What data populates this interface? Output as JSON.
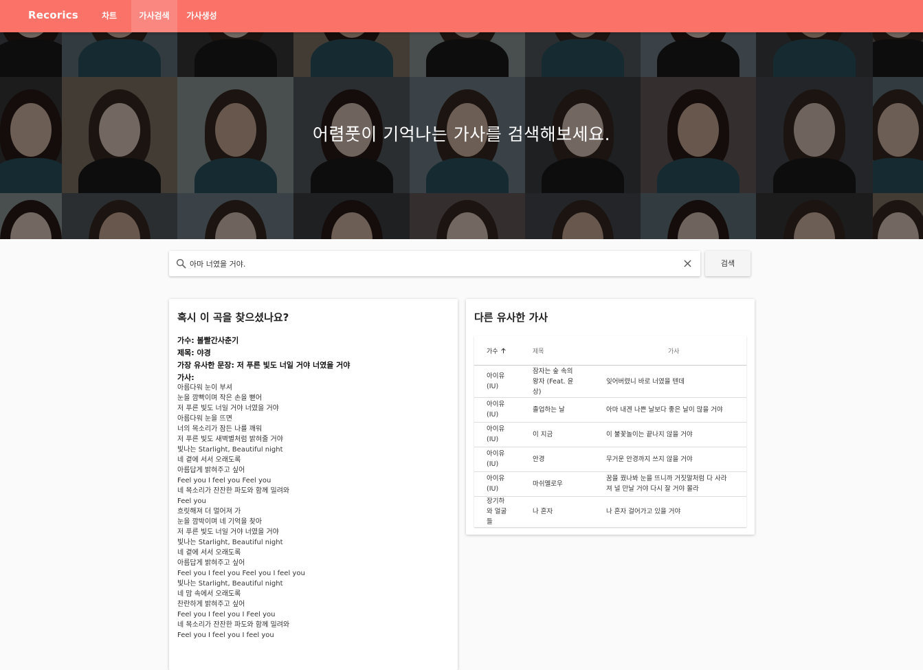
{
  "app": {
    "brand": "Recorics"
  },
  "nav": {
    "items": [
      {
        "label": "차트",
        "active": false
      },
      {
        "label": "가사검색",
        "active": true
      },
      {
        "label": "가사생성",
        "active": false
      }
    ]
  },
  "hero": {
    "title": "어렴풋이 기억나는 가사를 검색해보세요."
  },
  "search": {
    "value": "아마 너였을 거야.",
    "button_label": "검색"
  },
  "result": {
    "heading": "혹시 이 곡을 찾으셨나요?",
    "singer_label": "가수: 볼빨간사춘기",
    "title_label": "제목: 야경",
    "sentence_label": "가장 유사한 문장: 저 푸른 빛도 너일 거야 너였을 거야",
    "lyrics_label": "가사:",
    "lyrics": [
      "아름다워 눈이 부셔",
      "눈을 깜빡이며 작은 손을 뻗어",
      "저 푸른 빛도 너일 거야 너였을 거야",
      "아름다워 눈을 뜨면",
      "너의 목소리가 잠든 나를 깨워",
      "저 푸른 빛도 새벽별처럼 밝혀줄 거야",
      "빛나는 Starlight, Beautiful night",
      "네 곁에 서서 오래도록",
      "아름답게 밝혀주고 싶어",
      "Feel you I feel you Feel you",
      "네 목소리가 잔잔한 파도와 함께 밀려와",
      "Feel you",
      "흐릿해져 더 멀어져 가",
      "눈을 깜박이며 네 기억을 찾아",
      "저 푸른 빛도 너일 거야 너였을 거야",
      "빛나는 Starlight, Beautiful night",
      "네 곁에 서서 오래도록",
      "아름답게 밝혀주고 싶어",
      "Feel you I feel you Feel you I feel you",
      "빛나는 Starlight, Beautiful night",
      "네 맘 속에서 오래도록",
      "찬란하게 밝혀주고 싶어",
      "Feel you I feel you I Feel you",
      "네 목소리가 잔잔한 파도와 함께 밀려와",
      "Feel you I feel you I feel you"
    ]
  },
  "similar": {
    "heading": "다른 유사한 가사",
    "columns": [
      "가수",
      "제목",
      "가사"
    ],
    "rows": [
      {
        "singer": [
          "아이유",
          "(IU)"
        ],
        "title": [
          "잠자는 숲 속의",
          "왕자 (Feat. 윤",
          "상)"
        ],
        "lyric": [
          "잊어버렸니 바로 너였을 텐데"
        ]
      },
      {
        "singer": [
          "아이유",
          "(IU)"
        ],
        "title": [
          "졸업하는 날"
        ],
        "lyric": [
          "아마 내겐 나쁜 날보다 좋은 날이 많을 거야"
        ]
      },
      {
        "singer": [
          "아이유",
          "(IU)"
        ],
        "title": [
          "이 지금"
        ],
        "lyric": [
          "이 불꽃놀이는 끝나지 않을 거야"
        ]
      },
      {
        "singer": [
          "아이유",
          "(IU)"
        ],
        "title": [
          "안경"
        ],
        "lyric": [
          "무거운 안경까지 쓰지 않을 거야"
        ]
      },
      {
        "singer": [
          "아이유",
          "(IU)"
        ],
        "title": [
          "마쉬멜로우"
        ],
        "lyric": [
          "꿈을 꿨나봐 눈을 뜨니까 거짓말처럼 다 사라",
          "져 널 만날 거야 다시 잘 거야 몰라"
        ]
      },
      {
        "singer": [
          "장기하",
          "와 얼굴",
          "들"
        ],
        "title": [
          "나 혼자"
        ],
        "lyric": [
          "나 혼자 걸어가고 있을 거야"
        ]
      }
    ]
  },
  "colors": {
    "navbar": "#fa7268",
    "nav_active": "#fb8880",
    "background": "#fafafa"
  },
  "icons": {
    "search": "search-icon",
    "clear": "close-icon",
    "sort": "arrow-up-icon"
  }
}
